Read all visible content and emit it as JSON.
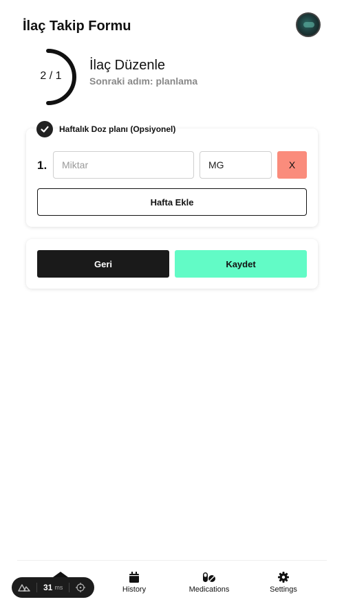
{
  "header": {
    "title": "İlaç Takip Formu"
  },
  "step": {
    "count": "2 / 1",
    "title": "İlaç Düzenle",
    "next": "Sonraki adım: planlama",
    "progress": 0.5
  },
  "weekly": {
    "label": "Haftalık Doz planı (Opsiyonel)",
    "checked": true,
    "row_number": "1.",
    "amount_placeholder": "Miktar",
    "amount_value": "",
    "unit_value": "MG",
    "remove_label": "X",
    "add_week_label": "Hafta Ekle"
  },
  "actions": {
    "back_label": "Geri",
    "save_label": "Kaydet"
  },
  "colors": {
    "save": "#62fbc6",
    "remove": "#fa8c7c",
    "dark": "#1a1a1a"
  },
  "tabs": {
    "history": "History",
    "medications": "Medications",
    "settings": "Settings"
  },
  "devtools": {
    "ms_value": "31",
    "ms_unit": "ms"
  }
}
